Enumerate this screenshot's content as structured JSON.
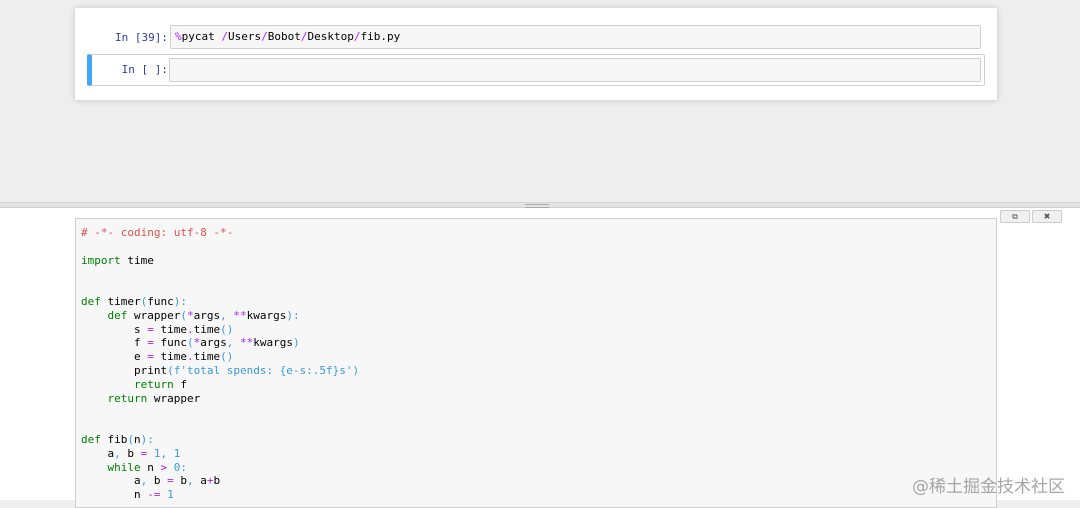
{
  "notebook": {
    "cells": [
      {
        "prompt": "In [39]:",
        "magic_pct": "%",
        "magic_name": "pycat",
        "path_segments": [
          "/",
          "Users",
          "/",
          "Bobot",
          "/",
          "Desktop",
          "/",
          "fib.py"
        ]
      },
      {
        "prompt": "In [ ]:",
        "code": ""
      }
    ]
  },
  "pager": {
    "buttons": {
      "open_icon": "external-link-icon",
      "open_glyph": "⧉",
      "close_icon": "close-icon",
      "close_glyph": "✖"
    },
    "code_lines": [
      [
        {
          "t": "# -*- coding: utf-8 -*-",
          "c": "comment"
        }
      ],
      [],
      [
        {
          "t": "import",
          "c": "kw"
        },
        {
          "t": " time",
          "c": ""
        }
      ],
      [],
      [],
      [
        {
          "t": "def",
          "c": "kw"
        },
        {
          "t": " timer",
          "c": ""
        },
        {
          "t": "(",
          "c": "paren"
        },
        {
          "t": "func",
          "c": ""
        },
        {
          "t": "):",
          "c": "paren"
        }
      ],
      [
        {
          "t": "    ",
          "c": ""
        },
        {
          "t": "def",
          "c": "kw"
        },
        {
          "t": " wrapper",
          "c": ""
        },
        {
          "t": "(",
          "c": "paren"
        },
        {
          "t": "*",
          "c": "op"
        },
        {
          "t": "args",
          "c": ""
        },
        {
          "t": ", ",
          "c": "paren"
        },
        {
          "t": "**",
          "c": "op"
        },
        {
          "t": "kwargs",
          "c": ""
        },
        {
          "t": "):",
          "c": "paren"
        }
      ],
      [
        {
          "t": "        s ",
          "c": ""
        },
        {
          "t": "=",
          "c": "op"
        },
        {
          "t": " time",
          "c": ""
        },
        {
          "t": ".",
          "c": "op"
        },
        {
          "t": "time",
          "c": ""
        },
        {
          "t": "()",
          "c": "paren"
        }
      ],
      [
        {
          "t": "        f ",
          "c": ""
        },
        {
          "t": "=",
          "c": "op"
        },
        {
          "t": " func",
          "c": ""
        },
        {
          "t": "(",
          "c": "paren"
        },
        {
          "t": "*",
          "c": "op"
        },
        {
          "t": "args",
          "c": ""
        },
        {
          "t": ", ",
          "c": "paren"
        },
        {
          "t": "**",
          "c": "op"
        },
        {
          "t": "kwargs",
          "c": ""
        },
        {
          "t": ")",
          "c": "paren"
        }
      ],
      [
        {
          "t": "        e ",
          "c": ""
        },
        {
          "t": "=",
          "c": "op"
        },
        {
          "t": " time",
          "c": ""
        },
        {
          "t": ".",
          "c": "op"
        },
        {
          "t": "time",
          "c": ""
        },
        {
          "t": "()",
          "c": "paren"
        }
      ],
      [
        {
          "t": "        print",
          "c": ""
        },
        {
          "t": "(",
          "c": "paren"
        },
        {
          "t": "f'total spends: {e-s:.5f}s'",
          "c": "str"
        },
        {
          "t": ")",
          "c": "paren"
        }
      ],
      [
        {
          "t": "        ",
          "c": ""
        },
        {
          "t": "return",
          "c": "kw"
        },
        {
          "t": " f",
          "c": ""
        }
      ],
      [
        {
          "t": "    ",
          "c": ""
        },
        {
          "t": "return",
          "c": "kw"
        },
        {
          "t": " wrapper",
          "c": ""
        }
      ],
      [],
      [],
      [
        {
          "t": "def",
          "c": "kw"
        },
        {
          "t": " fib",
          "c": ""
        },
        {
          "t": "(",
          "c": "paren"
        },
        {
          "t": "n",
          "c": ""
        },
        {
          "t": "):",
          "c": "paren"
        }
      ],
      [
        {
          "t": "    a",
          "c": ""
        },
        {
          "t": ", ",
          "c": "paren"
        },
        {
          "t": "b ",
          "c": ""
        },
        {
          "t": "=",
          "c": "op"
        },
        {
          "t": " ",
          "c": ""
        },
        {
          "t": "1",
          "c": "num"
        },
        {
          "t": ", ",
          "c": "paren"
        },
        {
          "t": "1",
          "c": "num"
        }
      ],
      [
        {
          "t": "    ",
          "c": ""
        },
        {
          "t": "while",
          "c": "kw"
        },
        {
          "t": " n ",
          "c": ""
        },
        {
          "t": ">",
          "c": "op"
        },
        {
          "t": " ",
          "c": ""
        },
        {
          "t": "0",
          "c": "num"
        },
        {
          "t": ":",
          "c": "paren"
        }
      ],
      [
        {
          "t": "        a",
          "c": ""
        },
        {
          "t": ", ",
          "c": "paren"
        },
        {
          "t": "b ",
          "c": ""
        },
        {
          "t": "=",
          "c": "op"
        },
        {
          "t": " b",
          "c": ""
        },
        {
          "t": ", ",
          "c": "paren"
        },
        {
          "t": "a",
          "c": ""
        },
        {
          "t": "+",
          "c": "op"
        },
        {
          "t": "b",
          "c": ""
        }
      ],
      [
        {
          "t": "        n ",
          "c": ""
        },
        {
          "t": "-=",
          "c": "op"
        },
        {
          "t": " ",
          "c": ""
        },
        {
          "t": "1",
          "c": "num"
        }
      ]
    ]
  },
  "watermark": "@稀土掘金技术社区",
  "colors": {
    "prompt": "#303f9f",
    "selected_border": "#42a5f5",
    "comment": "#d9534f",
    "keyword": "#008000",
    "operator": "#aa22ff",
    "number_string": "#3b9bd8"
  }
}
